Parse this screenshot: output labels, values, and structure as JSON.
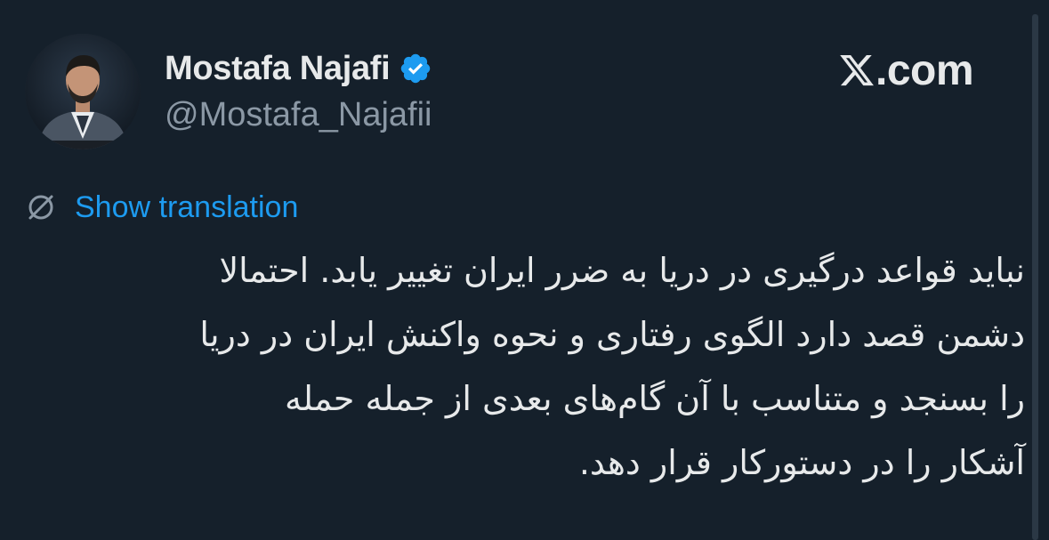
{
  "author": {
    "display_name": "Mostafa Najafi",
    "handle": "@Mostafa_Najafii",
    "verified": true,
    "verified_icon": "verified-badge-icon",
    "verified_color": "#1d9bf0",
    "avatar_icon": "avatar"
  },
  "brand": {
    "icon": "x-logo-icon",
    "text": ".com"
  },
  "translation": {
    "icon": "globe-slash-icon",
    "label": "Show translation",
    "color": "#1d9bf0"
  },
  "tweet": {
    "lines": [
      "نباید قواعد درگیری در دریا به ضرر ایران تغییر یابد. احتمالا",
      "دشمن قصد دارد الگوی رفتاری و نحوه واکنش ایران در دریا",
      "را بسنجد و متناسب با آن گام‌های بعدی از جمله حمله",
      "آشکار را در دستورکار قرار دهد."
    ]
  },
  "colors": {
    "background": "#15202b",
    "text_primary": "#e7e9ea",
    "text_secondary": "#8b98a5",
    "accent": "#1d9bf0"
  }
}
